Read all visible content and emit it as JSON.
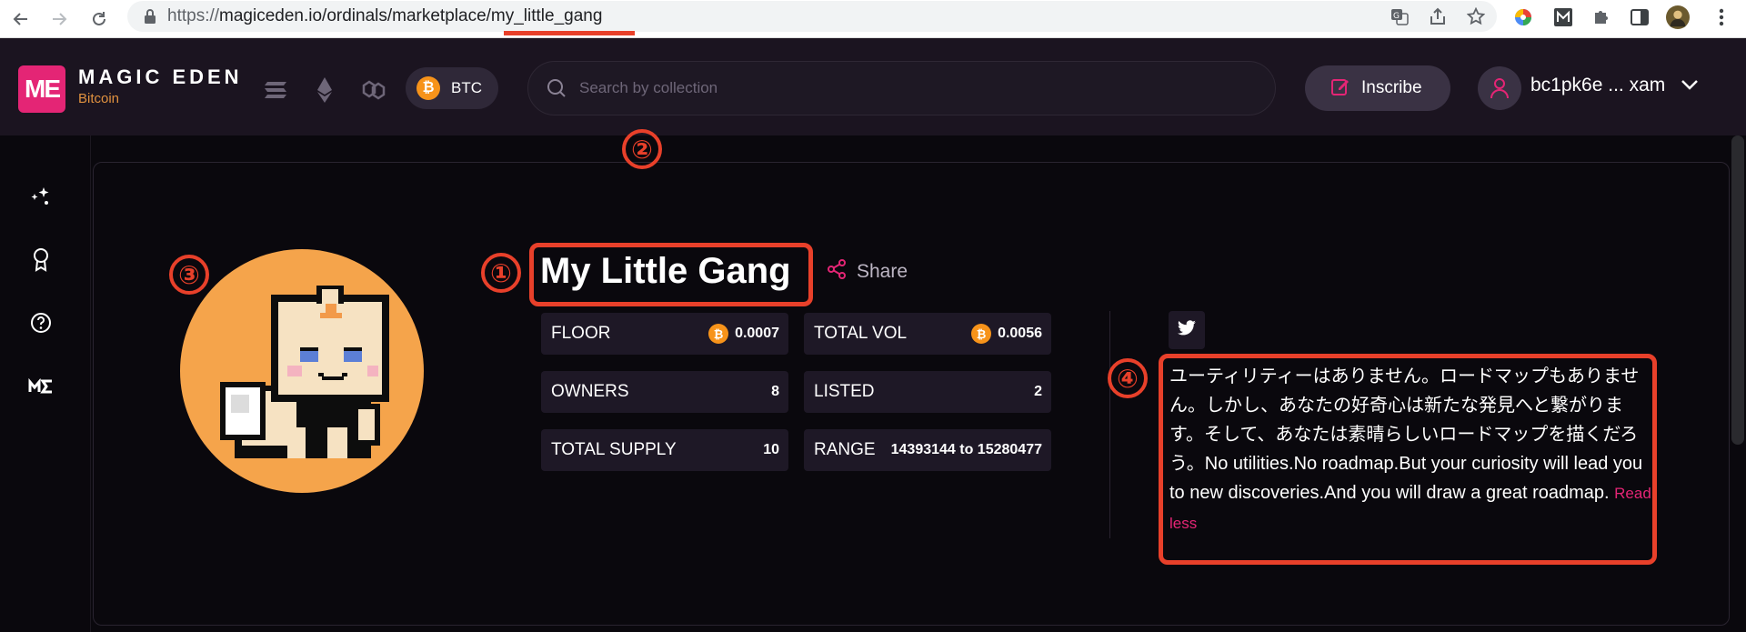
{
  "browser": {
    "url_prefix": "https://",
    "url_main": "magiceden.io/ordinals/marketplace/my_little_gang",
    "icons": [
      "back-icon",
      "forward-icon",
      "reload-icon",
      "lock-icon",
      "translate-icon",
      "share-icon",
      "star-icon",
      "extension-color-icon",
      "extension-m-icon",
      "puzzle-icon",
      "sidepanel-icon",
      "profile-avatar",
      "menu-dots-icon"
    ]
  },
  "header": {
    "logo_text": "ME",
    "brand_name": "MAGIC EDEN",
    "brand_sub": "Bitcoin",
    "chain_selected": "BTC",
    "search_placeholder": "Search by collection",
    "inscribe_label": "Inscribe",
    "wallet_address": "bc1pk6e ... xam"
  },
  "collection": {
    "title": "My Little Gang",
    "share_label": "Share",
    "stats": {
      "floor_label": "FLOOR",
      "floor_value": "0.0007",
      "total_vol_label": "TOTAL VOL",
      "total_vol_value": "0.0056",
      "owners_label": "OWNERS",
      "owners_value": "8",
      "listed_label": "LISTED",
      "listed_value": "2",
      "supply_label": "TOTAL SUPPLY",
      "supply_value": "10",
      "range_label": "RANGE",
      "range_value": "14393144 to 15280477"
    },
    "description": "ユーティリティーはありません。ロードマップもありません。しかし、あなたの好奇心は新たな発見へと繋がります。そして、あなたは素晴らしいロードマップを描くだろう。No utilities.No roadmap.But your curiosity will lead you to new discoveries.And you will draw a great roadmap.",
    "read_less": "Read less"
  },
  "annotations": {
    "n1": "①",
    "n2": "②",
    "n3": "③",
    "n4": "④"
  },
  "colors": {
    "accent": "#e42575",
    "bitcoin": "#f7931a",
    "annotation": "#e8402a",
    "background": "#0a080d",
    "header_bg": "#1b1420"
  }
}
